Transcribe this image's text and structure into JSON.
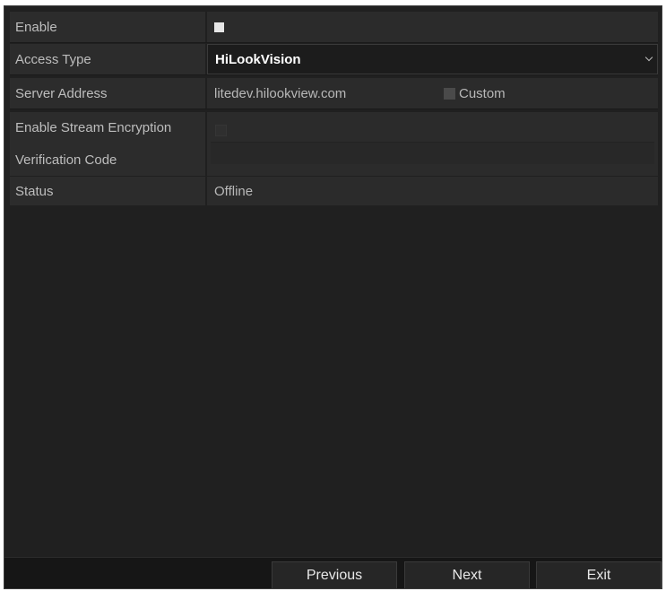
{
  "form": {
    "enable": {
      "label": "Enable",
      "checked": true
    },
    "access_type": {
      "label": "Access Type",
      "value": "HiLookVision"
    },
    "server_address": {
      "label": "Server Address",
      "value": "litedev.hilookview.com",
      "custom_label": "Custom",
      "custom_checked": false
    },
    "stream_encryption": {
      "label": "Enable Stream Encryption",
      "checked": false
    },
    "verification_code": {
      "label": "Verification Code",
      "value": ""
    },
    "status": {
      "label": "Status",
      "value": "Offline"
    }
  },
  "footer": {
    "previous_label": "Previous",
    "next_label": "Next",
    "exit_label": "Exit"
  },
  "colors": {
    "panel_bg": "#202020",
    "row_bg": "#2c2c2c",
    "text": "#bdbdbd",
    "selected_text": "#ffffff"
  }
}
